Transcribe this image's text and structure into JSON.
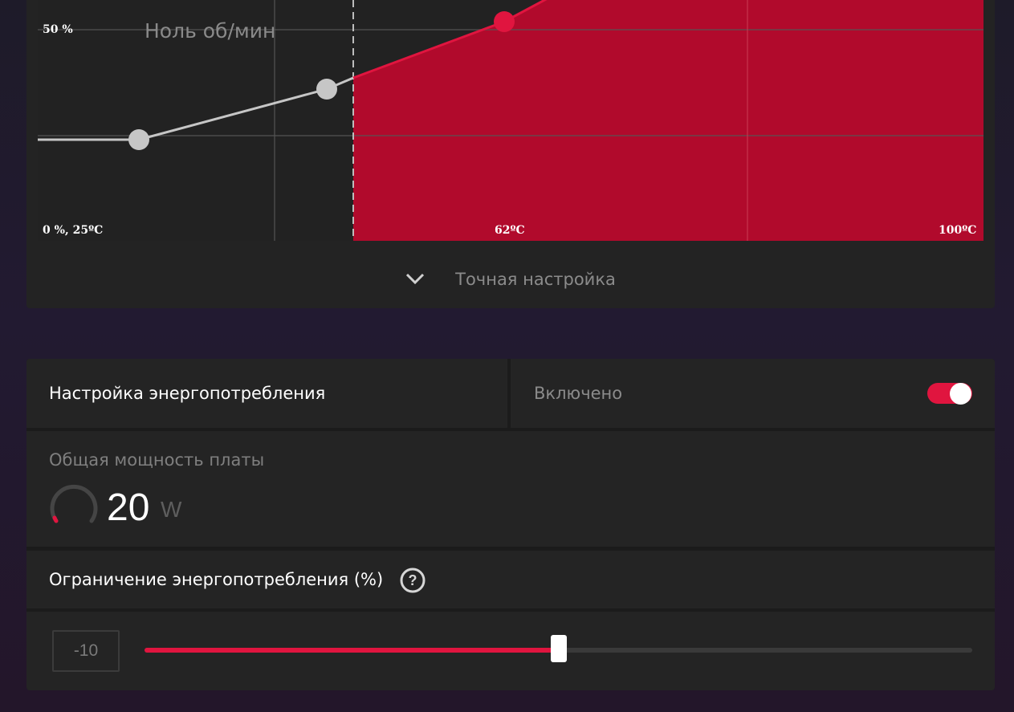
{
  "fan_curve": {
    "zero_rpm_label": "Ноль об/мин",
    "y_label_mid": "50 %",
    "origin_label": "0 %, 25ºC",
    "x_label_mid": "62ºC",
    "x_label_max": "100ºC",
    "fine_tune_label": "Точная настройка",
    "accent_color": "#b10a2c",
    "line_color": "#e0153f"
  },
  "power_tuning": {
    "title": "Настройка энергопотребления",
    "state_label": "Включено",
    "enabled": true
  },
  "board_power": {
    "title": "Общая мощность платы",
    "value": "20",
    "unit": "W"
  },
  "power_limit": {
    "title": "Ограничение энергопотребления (%)",
    "help_icon": "question-circle-icon",
    "value": "-10",
    "fraction": 0.5
  },
  "colors": {
    "accent": "#e0153f",
    "card": "#242424",
    "background": "#1e1b29"
  }
}
